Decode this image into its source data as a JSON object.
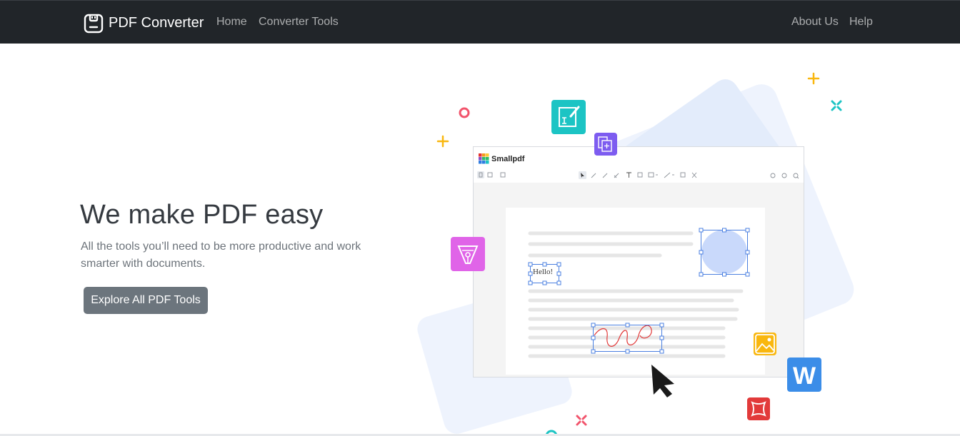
{
  "nav": {
    "brand": "PDF Converter",
    "links": [
      "Home",
      "Converter Tools"
    ],
    "right_links": [
      "About Us",
      "Help"
    ],
    "brand_icon": "clipboard-icon"
  },
  "hero": {
    "title": "We make PDF easy",
    "subtitle": "All the tools you’ll need to be more productive and work smarter with documents.",
    "button": "Explore All PDF Tools"
  },
  "illustration": {
    "app_name": "Smallpdf",
    "hello_text": "Hello!",
    "word_letter": "W",
    "colors": {
      "navbar": "#212529",
      "button": "#6c757d",
      "teal": "#1cc4c4",
      "purple": "#7d5cf0",
      "magenta": "#e064e8",
      "amber": "#f9b70f",
      "word_blue": "#3b8de8",
      "red": "#e23a3a",
      "selection": "#4a7fe0",
      "pink_ring": "#f2546c"
    },
    "icons": [
      "edit-text-icon",
      "add-page-icon",
      "pen-nib-icon",
      "image-icon",
      "word-icon",
      "crop-icon",
      "cursor-icon"
    ]
  }
}
